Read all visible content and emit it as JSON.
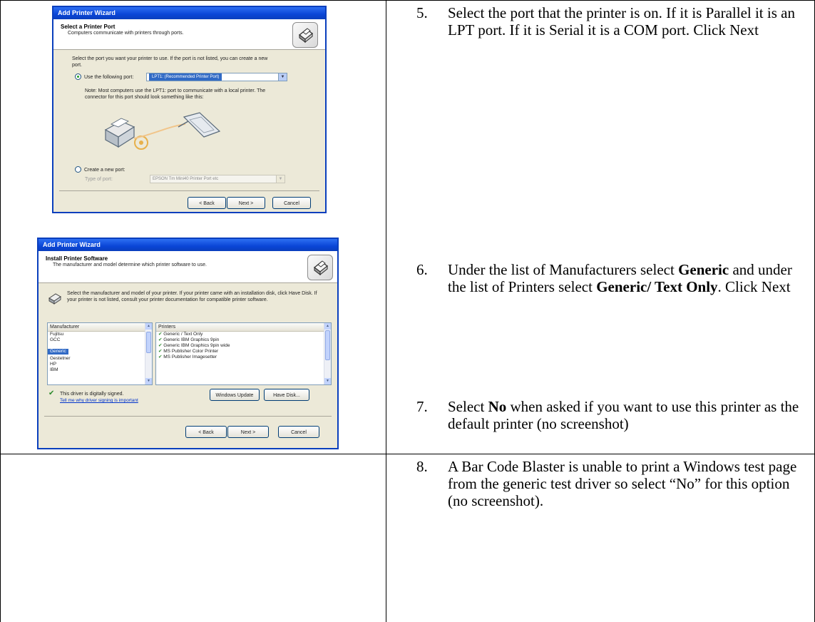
{
  "steps": [
    {
      "num": "5.",
      "text": "Select the port that the printer is on.  If it is Parallel it is an LPT port.  If it is Serial it is a COM port.  Click Next"
    },
    {
      "num": "6.",
      "t1": "Under the list of Manufacturers select ",
      "b1": "Generic",
      "t2": " and under the list of Printers select ",
      "b2": "Generic/ Text Only",
      "t3": ".  Click Next"
    },
    {
      "num": "7.",
      "t1": "Select ",
      "b1": "No",
      "t2": " when asked if you want to use this printer as the default printer (no screenshot)"
    },
    {
      "num": "8.",
      "text": "A Bar Code Blaster is unable to print a Windows test page from the generic test driver so select “No” for this option (no screenshot)."
    }
  ],
  "wizard_port": {
    "window_title": "Add Printer Wizard",
    "header_title": "Select a Printer Port",
    "header_subtitle": "Computers communicate with printers through ports.",
    "intro": "Select the port you want your printer to use.  If the port is not listed, you can create a new port.",
    "radio_use": "Use the following port:",
    "port_value": "LPT1: (Recommended Printer Port)",
    "note": "Note: Most computers use the LPT1: port to communicate with a local printer. The connector for this port should look something like this:",
    "radio_create": "Create a new port:",
    "type_label": "Type of port:",
    "type_value": "EPSON Tm Mini40 Printer Port etc",
    "back": "< Back",
    "next": "Next >",
    "cancel": "Cancel"
  },
  "wizard_software": {
    "window_title": "Add Printer Wizard",
    "header_title": "Install Printer Software",
    "header_subtitle": "The manufacturer and model determine which printer software to use.",
    "intro": "Select the manufacturer and model of your printer. If your printer came with an installation disk, click Have Disk. If your printer is not listed, consult your printer documentation for compatible printer software.",
    "manufacturer_header": "Manufacturer",
    "manufacturers": [
      "Fujitsu",
      "GCC",
      "Generic",
      "Gestetner",
      "HP",
      "IBM"
    ],
    "printers_header": "Printers",
    "printers": [
      "Generic / Text Only",
      "Generic IBM Graphics 9pin",
      "Generic IBM Graphics 9pin wide",
      "MS Publisher Color Printer",
      "MS Publisher Imagesetter"
    ],
    "signed": "This driver is digitally signed.",
    "signing_link": "Tell me why driver signing is important",
    "windows_update": "Windows Update",
    "have_disk": "Have Disk...",
    "back": "< Back",
    "next": "Next >",
    "cancel": "Cancel"
  },
  "icons": {
    "wizard_header": "printer-icon",
    "software_intro": "printer-icon",
    "signed": "signed-driver-icon"
  },
  "colors": {
    "titlebar": "#0a45d6",
    "dialog_bg": "#ece9d8",
    "selection": "#316ac5"
  }
}
